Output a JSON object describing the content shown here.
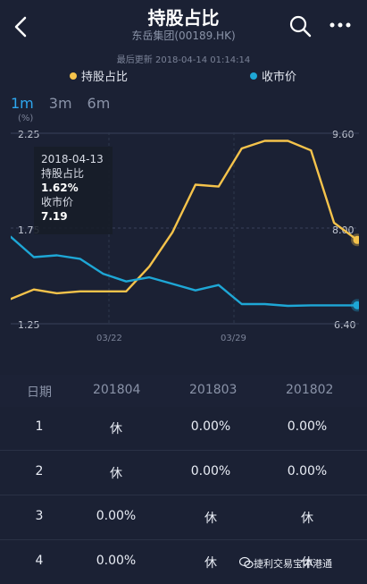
{
  "header": {
    "title": "持股占比",
    "subtitle": "东岳集团(00189.HK)",
    "updated": "最后更新 2018-04-14 01:14:14"
  },
  "legend": [
    {
      "label": "持股占比",
      "color": "#f5c34b"
    },
    {
      "label": "收市价",
      "color": "#1ea7d6"
    }
  ],
  "tabs": [
    {
      "label": "1m",
      "active": true
    },
    {
      "label": "3m",
      "active": false
    },
    {
      "label": "6m",
      "active": false
    }
  ],
  "chart_data": {
    "type": "line",
    "y_left_unit": "(%)",
    "y_left_ticks": [
      "2.25",
      "1.75",
      "1.25"
    ],
    "y_left_range": [
      1.25,
      2.25
    ],
    "y_right_ticks": [
      "9.60",
      "8.00",
      "6.40"
    ],
    "y_right_range": [
      6.4,
      9.6
    ],
    "x_tick_labels": [
      "03/22",
      "03/29"
    ],
    "series": [
      {
        "name": "持股占比",
        "color": "#f5c34b",
        "values": [
          1.38,
          1.43,
          1.41,
          1.42,
          1.42,
          1.42,
          1.55,
          1.73,
          1.98,
          1.97,
          2.17,
          2.21,
          2.21,
          2.16,
          1.78,
          1.69
        ]
      },
      {
        "name": "收市价",
        "color": "#1ea7d6",
        "values": [
          7.86,
          7.52,
          7.55,
          7.49,
          7.24,
          7.11,
          7.18,
          7.07,
          6.96,
          7.05,
          6.73,
          6.73,
          6.7,
          6.71,
          6.71,
          6.71
        ]
      }
    ],
    "tooltip": {
      "date": "2018-04-13",
      "series1_label": "持股占比",
      "series1_value": "1.62%",
      "series2_label": "收市价",
      "series2_value": "7.19"
    }
  },
  "table": {
    "headers": [
      "日期",
      "201804",
      "201803",
      "201802"
    ],
    "rows": [
      [
        "1",
        "休",
        "0.00%",
        "0.00%"
      ],
      [
        "2",
        "休",
        "0.00%",
        "0.00%"
      ],
      [
        "3",
        "0.00%",
        "休",
        "休"
      ],
      [
        "4",
        "0.00%",
        "休",
        "休"
      ]
    ]
  },
  "watermark": "捷利交易宝中港通"
}
